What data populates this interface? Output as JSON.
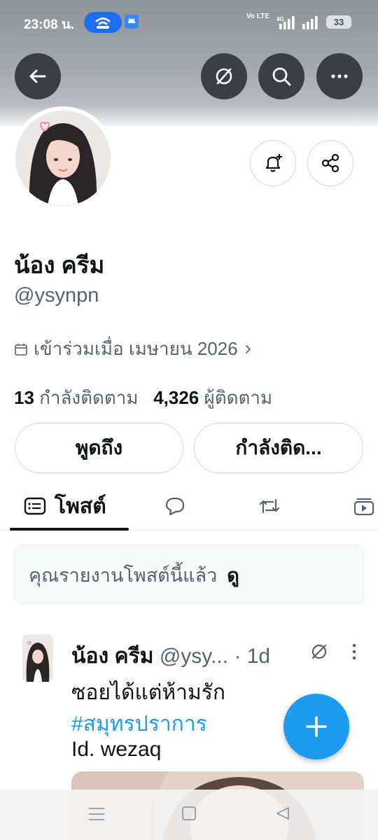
{
  "status_bar": {
    "time": "23:08 น.",
    "network_label": "Vo LTE",
    "network_type": "4G",
    "battery": "33"
  },
  "header": {
    "back_icon": "arrow-left-icon",
    "grok_icon": "slash-circle-icon",
    "search_icon": "search-icon",
    "more_icon": "more-horizontal-icon"
  },
  "profile": {
    "name": "น้อง ครีม",
    "handle": "@ysynpn",
    "joined": "เข้าร่วมเมื่อ เมษายน 2026",
    "following_count": "13",
    "following_label": "กำลังติดตาม",
    "followers_count": "4,326",
    "followers_label": "ผู้ติดตาม"
  },
  "actions": {
    "mention_label": "พูดถึง",
    "following_label": "กำลังติด..."
  },
  "tabs": [
    {
      "label": "โพสต์",
      "icon": "posts-icon",
      "active": true
    },
    {
      "label": "",
      "icon": "reply-bubble-icon",
      "active": false
    },
    {
      "label": "",
      "icon": "repost-icon",
      "active": false
    },
    {
      "label": "",
      "icon": "media-icon",
      "active": false
    }
  ],
  "notice": {
    "text": "คุณรายงานโพสต์นี้แล้ว",
    "link": "ดู"
  },
  "post": {
    "author_name": "น้อง ครีม",
    "author_handle": "@ysy...",
    "time": "· 1d",
    "line1": "ซอยได้แต่ห้ามรัก",
    "hashtag": "#สมุทรปราการ",
    "line3": "Id. wezaq"
  },
  "colors": {
    "accent": "#1d9bf0",
    "text_primary": "#0f1419",
    "text_secondary": "#536471",
    "header_button": "#3b3f44"
  }
}
